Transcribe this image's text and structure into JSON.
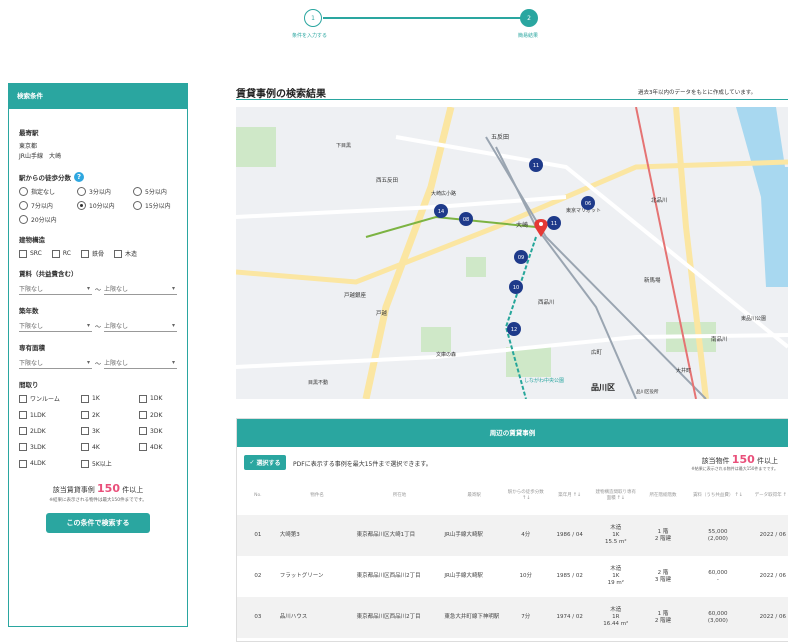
{
  "stepper": {
    "step1_num": "1",
    "step1_label": "条件を入力する",
    "step2_num": "2",
    "step2_label": "簡易結果"
  },
  "panel": {
    "header": "検索条件",
    "nearest_station_title": "最寄駅",
    "station_pref": "東京都",
    "station_line": "JR山手線　大崎",
    "walk_title": "駅からの徒歩分数",
    "walk_help": "?",
    "walk_options": [
      "指定なし",
      "3分以内",
      "5分以内",
      "7分以内",
      "10分以内",
      "15分以内",
      "20分以内"
    ],
    "walk_selected": "10分以内",
    "structure_title": "建物構造",
    "structure_options": [
      "SRC",
      "RC",
      "鉄骨",
      "木造"
    ],
    "rent_title": "賃料（共益費含む）",
    "rent_min": "下限なし",
    "rent_max": "上限なし",
    "age_title": "築年数",
    "age_min": "下限なし",
    "age_max": "上限なし",
    "area_title": "専有面積",
    "area_min": "下限なし",
    "area_max": "上限なし",
    "layout_title": "間取り",
    "layout_options": [
      "ワンルーム",
      "1K",
      "1DK",
      "1LDK",
      "2K",
      "2DK",
      "2LDK",
      "3K",
      "3DK",
      "3LDK",
      "4K",
      "4DK",
      "4LDK",
      "5K以上"
    ],
    "count_prefix": "該当賃貸事例",
    "count_num": "150",
    "count_suffix": "件以上",
    "count_note": "※結果に表示される物件は最大150件までです。",
    "search_button": "この条件で検索する",
    "tilde": "〜"
  },
  "results": {
    "title": "賃貸事例の検索結果",
    "note": "過去3年以内のデータをもとに作成しています。",
    "section_header": "周辺の賃貸事例",
    "select_button": "選択する",
    "select_text": "PDFに表示する事例を最大15件まで選択できます。",
    "count_prefix": "該当物件",
    "count_num": "150",
    "count_suffix": "件以上",
    "count_note": "※結果に表示される物件は最大150件までです。",
    "columns": [
      "No.",
      "物件名",
      "所在地",
      "最寄駅",
      "駅からの徒歩分数",
      "築年月",
      "建物構造間取り専有面積",
      "所在階総階数",
      "賃料（うち共益費）",
      "データ取得年"
    ],
    "rows": [
      {
        "no": "01",
        "name": "大崎第3",
        "address": "東京都品川区大崎1丁目",
        "station": "JR山手線大崎駅",
        "walk": "4分",
        "built": "1986 / 04",
        "structure": "木造",
        "layout": "1K",
        "area": "15.5 m²",
        "floor": "1 階",
        "floors_total": "2 階建",
        "rent": "55,000",
        "fee": "(2,000)",
        "year": "2022 / 06"
      },
      {
        "no": "02",
        "name": "フラットグリーン",
        "address": "東京都品川区西品川2丁目",
        "station": "JR山手線大崎駅",
        "walk": "10分",
        "built": "1985 / 02",
        "structure": "木造",
        "layout": "1K",
        "area": "19 m²",
        "floor": "2 階",
        "floors_total": "3 階建",
        "rent": "60,000",
        "fee": "-",
        "year": "2022 / 06"
      },
      {
        "no": "03",
        "name": "品川ハウス",
        "address": "東京都品川区西品川2丁目",
        "station": "東急大井町線下神明駅",
        "walk": "7分",
        "built": "1974 / 02",
        "structure": "木造",
        "layout": "1R",
        "area": "16.44 m²",
        "floor": "1 階",
        "floors_total": "2 階建",
        "rent": "60,000",
        "fee": "(3,000)",
        "year": "2022 / 06"
      }
    ]
  },
  "map": {
    "labels": [
      "五反田",
      "大崎",
      "大崎広小路",
      "西五反田",
      "戸越銀座",
      "戸越",
      "品川区",
      "品川区役所",
      "しながわ中央公園",
      "東京マリオット",
      "新馬場",
      "東品川公園",
      "南品川",
      "北品川",
      "広町",
      "文庫の森",
      "目黒不動",
      "下目黒",
      "西品川",
      "大井町"
    ],
    "pins": [
      "11",
      "14",
      "08",
      "11",
      "06",
      "09",
      "10",
      "12"
    ],
    "colors": {
      "pin": "#1e3a8a",
      "main_pin": "#e53935",
      "green": "#cfe8c8",
      "water": "#a8d8f0",
      "road": "#fbe6a2",
      "rail": "#9aa5b1"
    }
  }
}
